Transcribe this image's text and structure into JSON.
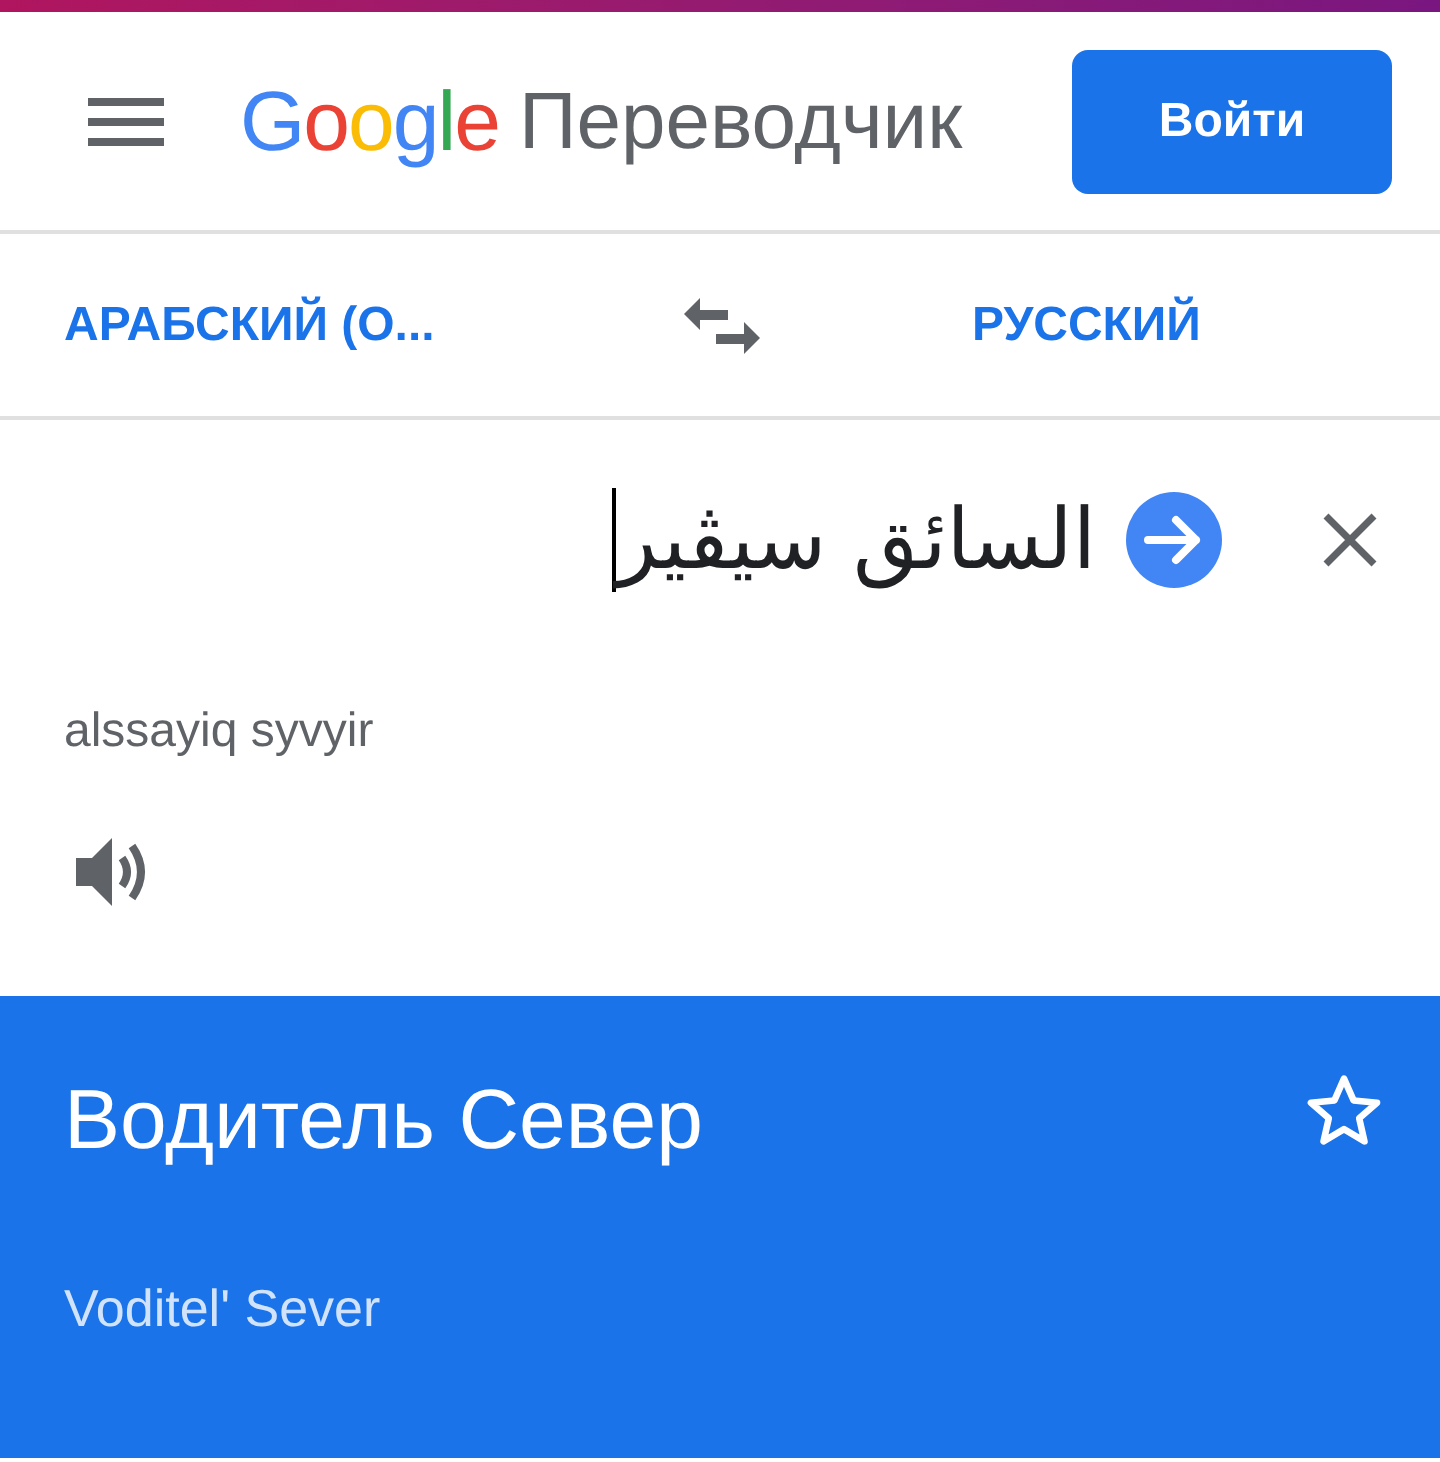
{
  "header": {
    "logo": "Google",
    "product": "Переводчик",
    "sign_in_button": "Войти"
  },
  "language_bar": {
    "source": "АРАБСКИЙ (О...",
    "target": "РУССКИЙ"
  },
  "input": {
    "value": "السائق سيڤير",
    "transliteration": "alssayiq syvyir"
  },
  "result": {
    "translation": "Водитель Север",
    "transliteration": "Voditel' Sever",
    "starred": false
  }
}
